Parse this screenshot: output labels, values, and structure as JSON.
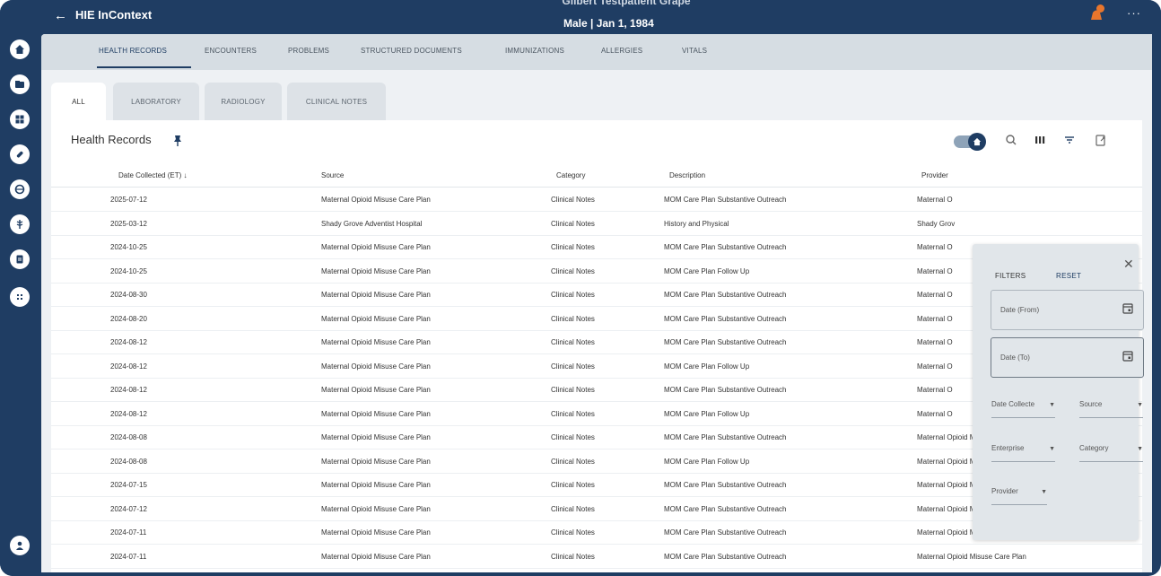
{
  "app": {
    "back": "←",
    "title": "HIE InContext"
  },
  "patient": {
    "name": "Gilbert Testpatient Grape",
    "info": "Male | Jan 1, 1984"
  },
  "topbar": {
    "more": "···"
  },
  "nav_tabs": [
    "HEALTH RECORDS",
    "ENCOUNTERS",
    "PROBLEMS",
    "STRUCTURED DOCUMENTS",
    "IMMUNIZATIONS",
    "ALLERGIES",
    "VITALS"
  ],
  "sub_tabs": [
    "ALL",
    "LABORATORY",
    "RADIOLOGY",
    "CLINICAL NOTES"
  ],
  "panel": {
    "title": "Health Records"
  },
  "columns": {
    "date": "Date Collected (ET) ↓",
    "source": "Source",
    "category": "Category",
    "description": "Description",
    "provider": "Provider"
  },
  "rows": [
    {
      "date": "2025-07-12",
      "source": "Maternal Opioid Misuse Care Plan",
      "category": "Clinical Notes",
      "description": "MOM Care Plan Substantive Outreach",
      "provider": "Maternal O"
    },
    {
      "date": "2025-03-12",
      "source": "Shady Grove Adventist Hospital",
      "category": "Clinical Notes",
      "description": "History and Physical",
      "provider": "Shady Grov"
    },
    {
      "date": "2024-10-25",
      "source": "Maternal Opioid Misuse Care Plan",
      "category": "Clinical Notes",
      "description": "MOM Care Plan Substantive Outreach",
      "provider": "Maternal O"
    },
    {
      "date": "2024-10-25",
      "source": "Maternal Opioid Misuse Care Plan",
      "category": "Clinical Notes",
      "description": "MOM Care Plan Follow Up",
      "provider": "Maternal O"
    },
    {
      "date": "2024-08-30",
      "source": "Maternal Opioid Misuse Care Plan",
      "category": "Clinical Notes",
      "description": "MOM Care Plan Substantive Outreach",
      "provider": "Maternal O"
    },
    {
      "date": "2024-08-20",
      "source": "Maternal Opioid Misuse Care Plan",
      "category": "Clinical Notes",
      "description": "MOM Care Plan Substantive Outreach",
      "provider": "Maternal O"
    },
    {
      "date": "2024-08-12",
      "source": "Maternal Opioid Misuse Care Plan",
      "category": "Clinical Notes",
      "description": "MOM Care Plan Substantive Outreach",
      "provider": "Maternal O"
    },
    {
      "date": "2024-08-12",
      "source": "Maternal Opioid Misuse Care Plan",
      "category": "Clinical Notes",
      "description": "MOM Care Plan Follow Up",
      "provider": "Maternal O"
    },
    {
      "date": "2024-08-12",
      "source": "Maternal Opioid Misuse Care Plan",
      "category": "Clinical Notes",
      "description": "MOM Care Plan Substantive Outreach",
      "provider": "Maternal O"
    },
    {
      "date": "2024-08-12",
      "source": "Maternal Opioid Misuse Care Plan",
      "category": "Clinical Notes",
      "description": "MOM Care Plan Follow Up",
      "provider": "Maternal O"
    },
    {
      "date": "2024-08-08",
      "source": "Maternal Opioid Misuse Care Plan",
      "category": "Clinical Notes",
      "description": "MOM Care Plan Substantive Outreach",
      "provider": "Maternal Opioid Misuse Care Plan"
    },
    {
      "date": "2024-08-08",
      "source": "Maternal Opioid Misuse Care Plan",
      "category": "Clinical Notes",
      "description": "MOM Care Plan Follow Up",
      "provider": "Maternal Opioid Misuse Care Plan"
    },
    {
      "date": "2024-07-15",
      "source": "Maternal Opioid Misuse Care Plan",
      "category": "Clinical Notes",
      "description": "MOM Care Plan Substantive Outreach",
      "provider": "Maternal Opioid Misuse Care Plan"
    },
    {
      "date": "2024-07-12",
      "source": "Maternal Opioid Misuse Care Plan",
      "category": "Clinical Notes",
      "description": "MOM Care Plan Substantive Outreach",
      "provider": "Maternal Opioid Misuse Care Plan"
    },
    {
      "date": "2024-07-11",
      "source": "Maternal Opioid Misuse Care Plan",
      "category": "Clinical Notes",
      "description": "MOM Care Plan Substantive Outreach",
      "provider": "Maternal Opioid Misuse Care Plan"
    },
    {
      "date": "2024-07-11",
      "source": "Maternal Opioid Misuse Care Plan",
      "category": "Clinical Notes",
      "description": "MOM Care Plan Substantive Outreach",
      "provider": "Maternal Opioid Misuse Care Plan"
    }
  ],
  "filters": {
    "title": "FILTERS",
    "reset": "RESET",
    "close": "✕",
    "date_from": "Date (From)",
    "date_to": "Date (To)",
    "date_collected": "Date Collecte",
    "source": "Source",
    "enterprise": "Enterprise",
    "category": "Category",
    "provider": "Provider",
    "caret": "▼"
  },
  "colors": {
    "navy": "#1f3d63",
    "accent": "#e8762d",
    "nav_bg": "#d6dde3"
  }
}
